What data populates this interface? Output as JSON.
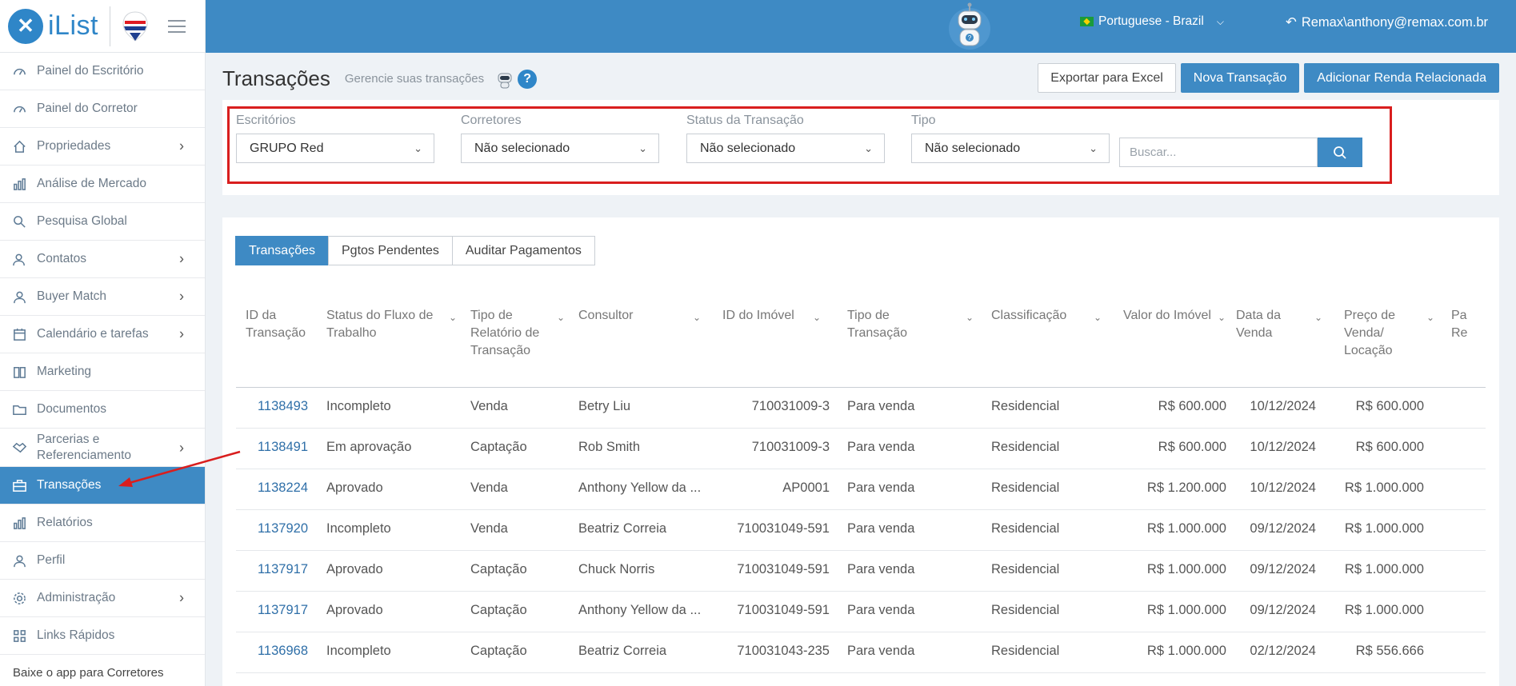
{
  "brand": {
    "name": "iList",
    "logo_glyph": "✕",
    "partner_text": "RE/MAX"
  },
  "sidebar": {
    "items": [
      {
        "label": "Painel do Escritório",
        "icon": "gauge-icon",
        "chevron": false
      },
      {
        "label": "Painel do Corretor",
        "icon": "gauge-icon",
        "chevron": false
      },
      {
        "label": "Propriedades",
        "icon": "home-icon",
        "chevron": true
      },
      {
        "label": "Análise de Mercado",
        "icon": "bar-chart-icon",
        "chevron": false
      },
      {
        "label": "Pesquisa Global",
        "icon": "search-icon",
        "chevron": false
      },
      {
        "label": "Contatos",
        "icon": "users-icon",
        "chevron": true
      },
      {
        "label": "Buyer Match",
        "icon": "user-icon",
        "chevron": true
      },
      {
        "label": "Calendário e tarefas",
        "icon": "calendar-icon",
        "chevron": true
      },
      {
        "label": "Marketing",
        "icon": "book-icon",
        "chevron": false
      },
      {
        "label": "Documentos",
        "icon": "folder-icon",
        "chevron": false
      },
      {
        "label": "Parcerias e Referenciamento",
        "icon": "handshake-icon",
        "chevron": true
      },
      {
        "label": "Transações",
        "icon": "briefcase-icon",
        "chevron": false,
        "active": true
      },
      {
        "label": "Relatórios",
        "icon": "bar-chart-icon",
        "chevron": false
      },
      {
        "label": "Perfil",
        "icon": "user-icon",
        "chevron": false
      },
      {
        "label": "Administração",
        "icon": "gear-icon",
        "chevron": true
      },
      {
        "label": "Links Rápidos",
        "icon": "grid-icon",
        "chevron": false
      }
    ],
    "footer": "Baixe o app para Corretores"
  },
  "topbar": {
    "language": "Portuguese - Brazil",
    "user": "Remax\\anthony@remax.com.br"
  },
  "page": {
    "title": "Transações",
    "subtitle": "Gerencie suas transações",
    "help": "?"
  },
  "actions": {
    "export": "Exportar para Excel",
    "new_transaction": "Nova Transação",
    "add_income": "Adicionar Renda Relacionada"
  },
  "filters": {
    "offices": {
      "label": "Escritórios",
      "value": "GRUPO Red"
    },
    "brokers": {
      "label": "Corretores",
      "value": "Não selecionado"
    },
    "status": {
      "label": "Status da Transação",
      "value": "Não selecionado"
    },
    "type": {
      "label": "Tipo",
      "value": "Não selecionado"
    },
    "search_placeholder": "Buscar..."
  },
  "tabs": [
    "Transações",
    "Pgtos Pendentes",
    "Auditar Pagamentos"
  ],
  "table": {
    "columns": [
      "ID da Transação",
      "Status do Fluxo de Trabalho",
      "Tipo de Relatório de Transação",
      "Consultor",
      "ID do Imóvel",
      "Tipo de Transação",
      "Classificação",
      "Valor do Imóvel",
      "Data da Venda",
      "Preço de Venda/ Locação",
      "Pa Re"
    ],
    "rows": [
      [
        "1138493",
        "Incompleto",
        "Venda",
        "Betry Liu",
        "710031009-3",
        "Para venda",
        "Residencial",
        "R$ 600.000",
        "10/12/2024",
        "R$ 600.000"
      ],
      [
        "1138491",
        "Em aprovação",
        "Captação",
        "Rob Smith",
        "710031009-3",
        "Para venda",
        "Residencial",
        "R$ 600.000",
        "10/12/2024",
        "R$ 600.000"
      ],
      [
        "1138224",
        "Aprovado",
        "Venda",
        "Anthony Yellow da ...",
        "AP0001",
        "Para venda",
        "Residencial",
        "R$ 1.200.000",
        "10/12/2024",
        "R$ 1.000.000"
      ],
      [
        "1137920",
        "Incompleto",
        "Venda",
        "Beatriz Correia",
        "710031049-591",
        "Para venda",
        "Residencial",
        "R$ 1.000.000",
        "09/12/2024",
        "R$ 1.000.000"
      ],
      [
        "1137917",
        "Aprovado",
        "Captação",
        "Chuck Norris",
        "710031049-591",
        "Para venda",
        "Residencial",
        "R$ 1.000.000",
        "09/12/2024",
        "R$ 1.000.000"
      ],
      [
        "1137917",
        "Aprovado",
        "Captação",
        "Anthony Yellow da ...",
        "710031049-591",
        "Para venda",
        "Residencial",
        "R$ 1.000.000",
        "09/12/2024",
        "R$ 1.000.000"
      ],
      [
        "1136968",
        "Incompleto",
        "Captação",
        "Beatriz Correia",
        "710031043-235",
        "Para venda",
        "Residencial",
        "R$ 1.000.000",
        "02/12/2024",
        "R$ 556.666"
      ]
    ]
  },
  "colors": {
    "primary": "#3e8ac4",
    "highlight": "#d91e1e",
    "link": "#2f6fa8"
  }
}
